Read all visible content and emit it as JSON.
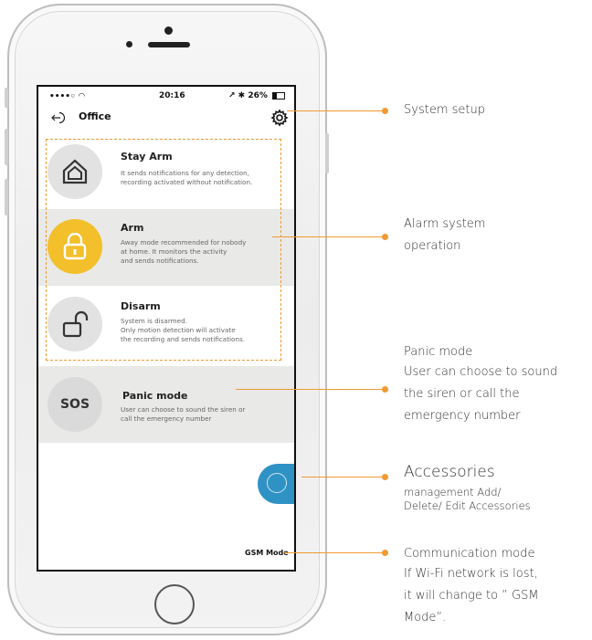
{
  "status_bar": {
    "signal": "••••◦ ◠",
    "time": "20:16",
    "battery": "↗ ✱ 26%"
  },
  "nav": {
    "title": "Office"
  },
  "modes": [
    {
      "title": "Stay Arm",
      "description": "It sends notifications for any detection,\nrecording activated without notification."
    },
    {
      "title": "Arm",
      "description": "Away mode recommended for nobody\nat home. It monitors the activity\nand sends notifications."
    },
    {
      "title": "Disarm",
      "description": "System is disarmed.\nOnly motion detection will activate\nthe recording and sends notifications."
    }
  ],
  "panic": {
    "icon_text": "SOS",
    "title": "Panic mode",
    "description": "User can choose to sound the siren or\ncall the emergency number"
  },
  "gsm_label": "GSM Mode",
  "annotations": {
    "system_setup": "System setup",
    "alarm_line1": "Alarm system",
    "alarm_line2": "operation",
    "panic_title": "Panic mode",
    "panic_line1": "User can choose to sound",
    "panic_line2": "the siren or call the",
    "panic_line3": "emergency number",
    "accessories_title": "Accessories",
    "accessories_line1": "management Add/",
    "accessories_line2": "Delete/ Edit Accessories",
    "comm_title": "Communication mode",
    "comm_line1": "If Wi-Fi network is lost,",
    "comm_line2": "it will change to ” GSM",
    "comm_line3": "Mode”."
  },
  "colors": {
    "accent": "#f09a32",
    "arm_yellow": "#f3bf2a",
    "accessories_blue": "#2f92c4",
    "row_gray": "#e9e9e7"
  }
}
